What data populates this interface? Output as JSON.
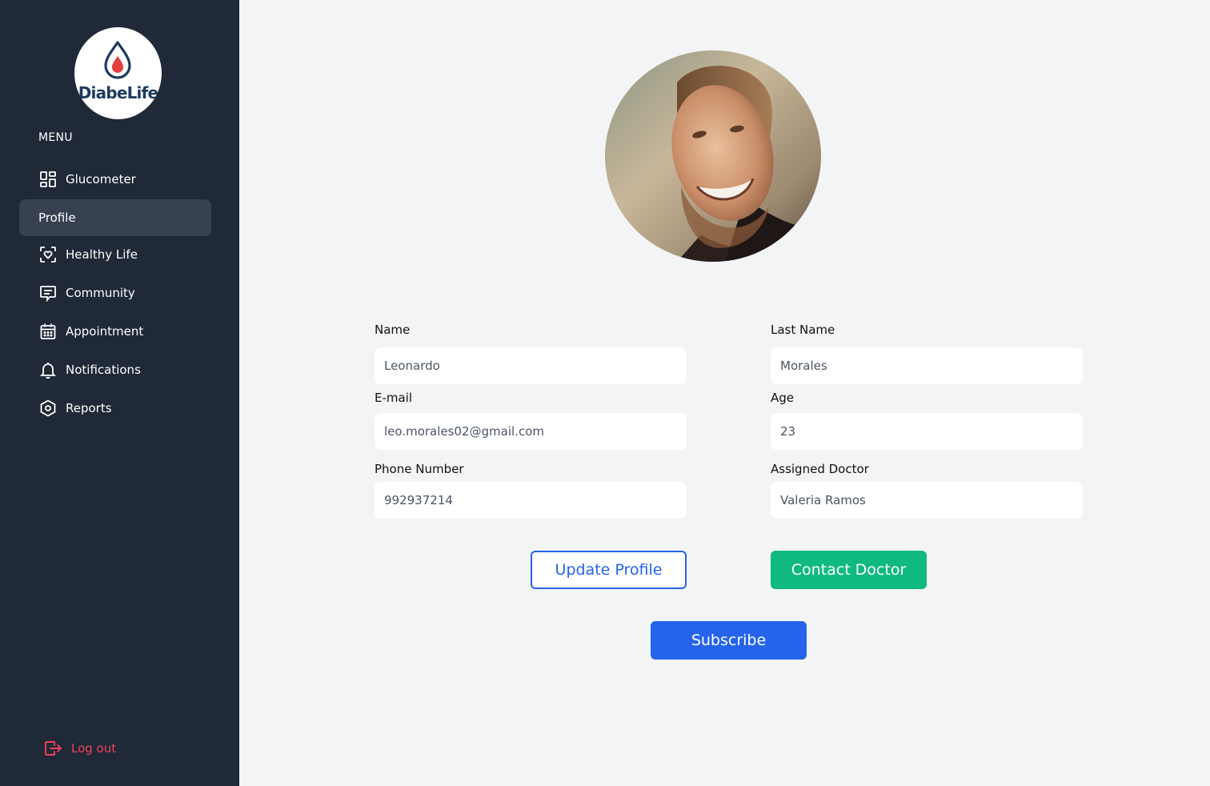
{
  "app": {
    "name": "DiabeLife"
  },
  "sidebar": {
    "menu_heading": "MENU",
    "items": [
      {
        "label": "Glucometer",
        "icon": "dashboard-grid-icon"
      },
      {
        "label": "Profile",
        "icon": "",
        "active": true
      },
      {
        "label": "Healthy Life",
        "icon": "heart-scan-icon"
      },
      {
        "label": "Community",
        "icon": "chat-message-icon"
      },
      {
        "label": "Appointment",
        "icon": "calendar-icon"
      },
      {
        "label": "Notifications",
        "icon": "bell-icon"
      },
      {
        "label": "Reports",
        "icon": "hexagon-settings-icon"
      }
    ],
    "logout_label": "Log out"
  },
  "profile": {
    "fields": {
      "name": {
        "label": "Name",
        "value": "Leonardo"
      },
      "last_name": {
        "label": "Last Name",
        "value": "Morales"
      },
      "email": {
        "label": "E-mail",
        "value": "leo.morales02@gmail.com"
      },
      "age": {
        "label": "Age",
        "value": "23"
      },
      "phone": {
        "label": "Phone Number",
        "value": "992937214"
      },
      "doctor": {
        "label": "Assigned Doctor",
        "value": "Valeria Ramos"
      }
    },
    "buttons": {
      "update": "Update Profile",
      "contact": "Contact Doctor",
      "subscribe": "Subscribe"
    }
  },
  "colors": {
    "sidebar_bg": "#1f2937",
    "active_item_bg": "#374151",
    "page_bg": "#f3f4f6",
    "primary_blue": "#2563eb",
    "accent_green": "#10b981",
    "logout_red": "#f43f5e",
    "logo_drop_red": "#e53e3e",
    "logo_navy": "#1e3a5f"
  }
}
